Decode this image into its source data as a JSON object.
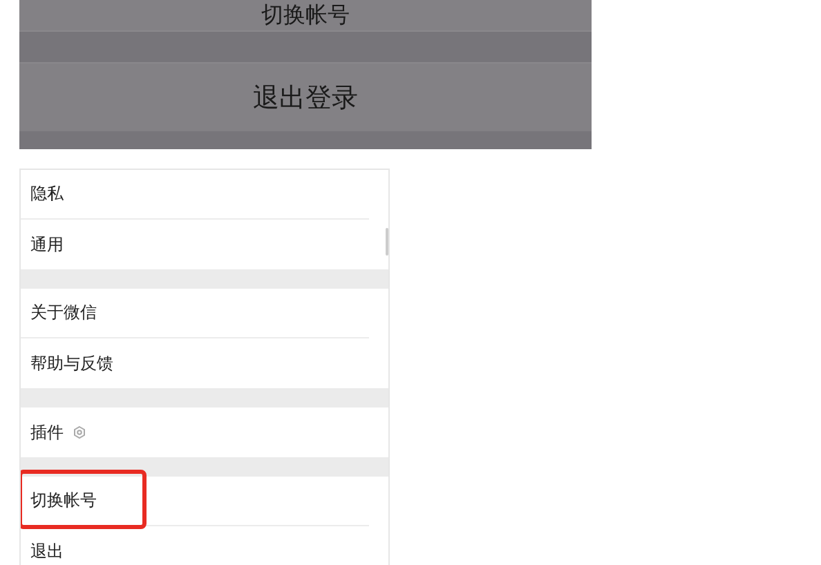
{
  "top_panel": {
    "buttons": [
      {
        "label": "切换帐号"
      },
      {
        "label": "退出登录"
      }
    ]
  },
  "settings": {
    "groups": [
      {
        "items": [
          {
            "label": "隐私",
            "kind": "plain",
            "highlighted": false
          },
          {
            "label": "通用",
            "kind": "plain",
            "highlighted": false
          }
        ]
      },
      {
        "items": [
          {
            "label": "关于微信",
            "kind": "plain",
            "highlighted": false
          },
          {
            "label": "帮助与反馈",
            "kind": "plain",
            "highlighted": false
          }
        ]
      },
      {
        "items": [
          {
            "label": "插件",
            "kind": "with_icon",
            "highlighted": false
          }
        ]
      },
      {
        "items": [
          {
            "label": "切换帐号",
            "kind": "plain",
            "highlighted": true
          },
          {
            "label": "退出",
            "kind": "plain",
            "highlighted": false
          }
        ]
      }
    ]
  }
}
